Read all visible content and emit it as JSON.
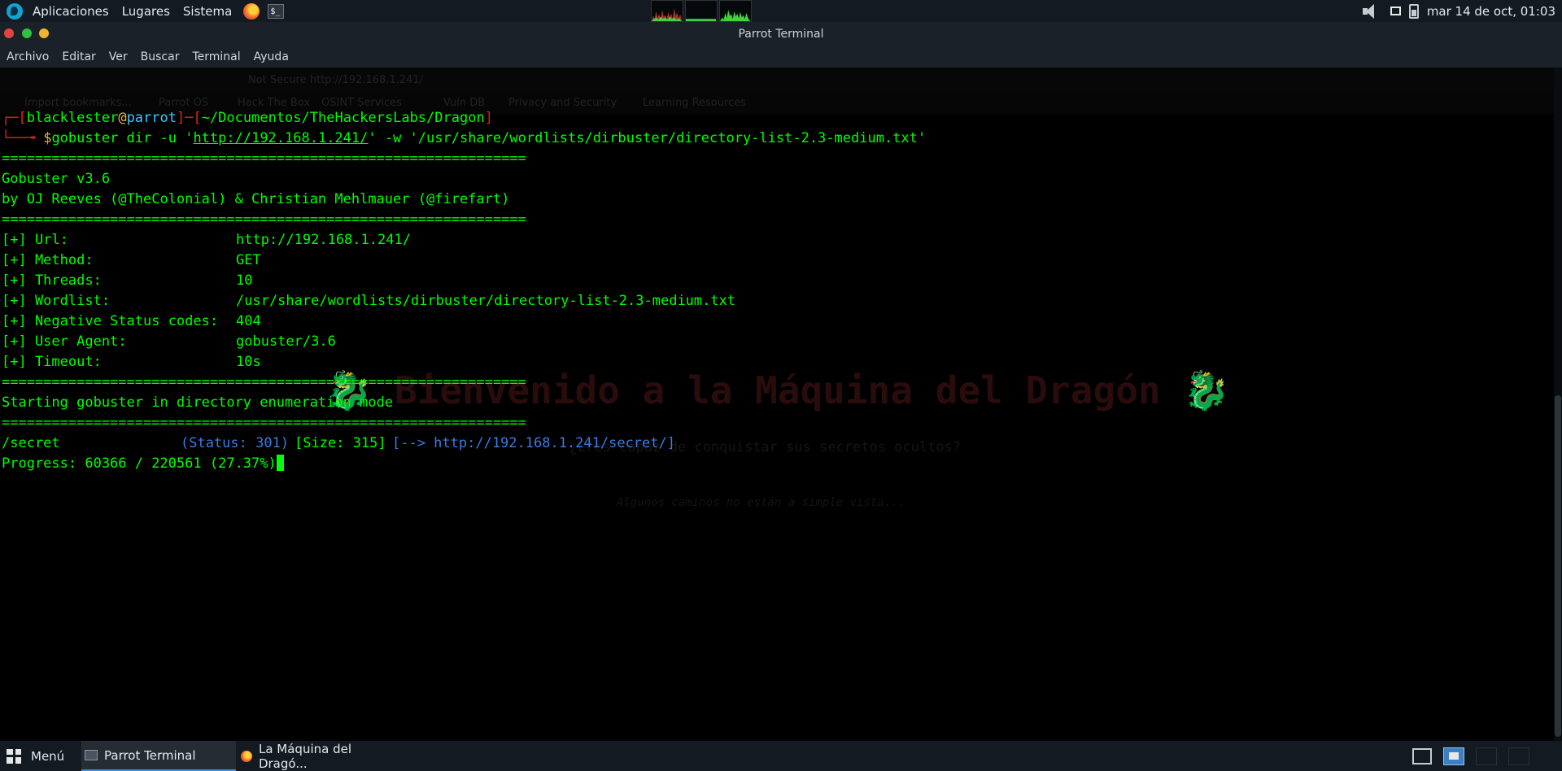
{
  "top_panel": {
    "apps_label": "Aplicaciones",
    "places_label": "Lugares",
    "system_label": "Sistema",
    "clock": "mar 14 de oct, 01:03"
  },
  "window": {
    "title": "Parrot Terminal",
    "menu": [
      "Archivo",
      "Editar",
      "Ver",
      "Buscar",
      "Terminal",
      "Ayuda"
    ]
  },
  "background_browser": {
    "address": "Not Secure   http://192.168.1.241/",
    "bookmarks": [
      "Import bookmarks...",
      "Parrot OS",
      "Hack The Box",
      "OSINT Services",
      "Vuln DB",
      "Privacy and Security",
      "Learning Resources"
    ],
    "heading": "🐉 Bienvenido a la Máquina del Dragón 🐉",
    "subheading": "¿Eres capaz de conquistar sus secretos ocultos?",
    "hint": "Algunos caminos no están a simple vista..."
  },
  "terminal": {
    "prompt": {
      "user": "blacklester",
      "at": "@",
      "host": "parrot",
      "path": "~/Documentos/TheHackersLabs/Dragon"
    },
    "command": {
      "prefix": "gobuster dir -u '",
      "url": "http://192.168.1.241/",
      "suffix": "' -w '/usr/share/wordlists/dirbuster/directory-list-2.3-medium.txt'"
    },
    "separator": "===============================================================",
    "banner_version": "Gobuster v3.6",
    "banner_authors": "by OJ Reeves (@TheColonial) & Christian Mehlmauer (@firefart)",
    "config": [
      {
        "key": "[+] Url:",
        "value": "http://192.168.1.241/"
      },
      {
        "key": "[+] Method:",
        "value": "GET"
      },
      {
        "key": "[+] Threads:",
        "value": "10"
      },
      {
        "key": "[+] Wordlist:",
        "value": "/usr/share/wordlists/dirbuster/directory-list-2.3-medium.txt"
      },
      {
        "key": "[+] Negative Status codes:",
        "value": "404"
      },
      {
        "key": "[+] User Agent:",
        "value": "gobuster/3.6"
      },
      {
        "key": "[+] Timeout:",
        "value": "10s"
      }
    ],
    "mode_line": "Starting gobuster in directory enumeration mode",
    "result": {
      "path": "/secret",
      "status": "(Status: 301)",
      "size": "[Size: 315]",
      "redirect": "[--> http://192.168.1.241/secret/]"
    },
    "progress": "Progress: 60366 / 220561 (27.37%)"
  },
  "taskbar": {
    "menu_label": "Menú",
    "tasks": [
      "Parrot Terminal",
      "La Máquina del Dragó..."
    ]
  }
}
